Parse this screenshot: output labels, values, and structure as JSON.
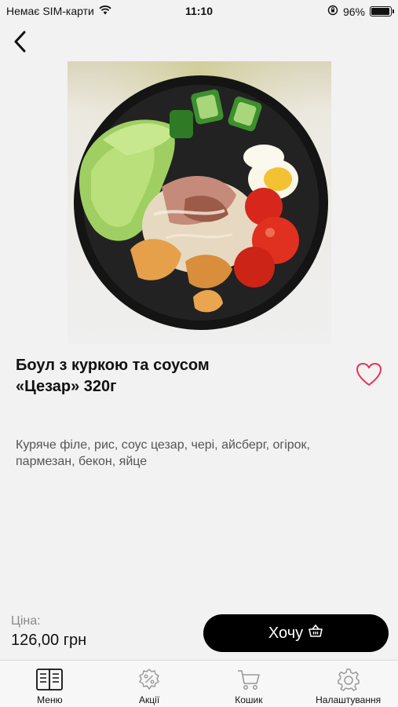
{
  "status_bar": {
    "carrier": "Немає SIM-карти",
    "time": "11:10",
    "battery_percent": "96%",
    "battery_level": 0.96,
    "icons": [
      "wifi-icon",
      "orientation-lock-icon",
      "battery-icon"
    ]
  },
  "nav": {
    "back_icon": "chevron-left-icon"
  },
  "dish": {
    "image": "caesar-bowl-photo",
    "title_line1": "Боул з куркою та соусом",
    "title_line2": "«Цезар» 320г",
    "description_line1": "Куряче філе, рис, соус цезар, чері, айсберг, огірок,",
    "description_line2": "пармезан, бекон, яйце",
    "favorite_icon": "heart-outline-icon",
    "favorite_color": "#e8325a"
  },
  "order": {
    "price_label": "Ціна:",
    "price_value": "126,00 грн",
    "want_label": "Хочу",
    "want_icon": "basket-icon"
  },
  "tabs": [
    {
      "label": "Меню",
      "icon": "menu-book-icon"
    },
    {
      "label": "Акції",
      "icon": "percent-badge-icon"
    },
    {
      "label": "Кошик",
      "icon": "cart-icon"
    },
    {
      "label": "Налаштування",
      "icon": "gear-icon"
    }
  ]
}
